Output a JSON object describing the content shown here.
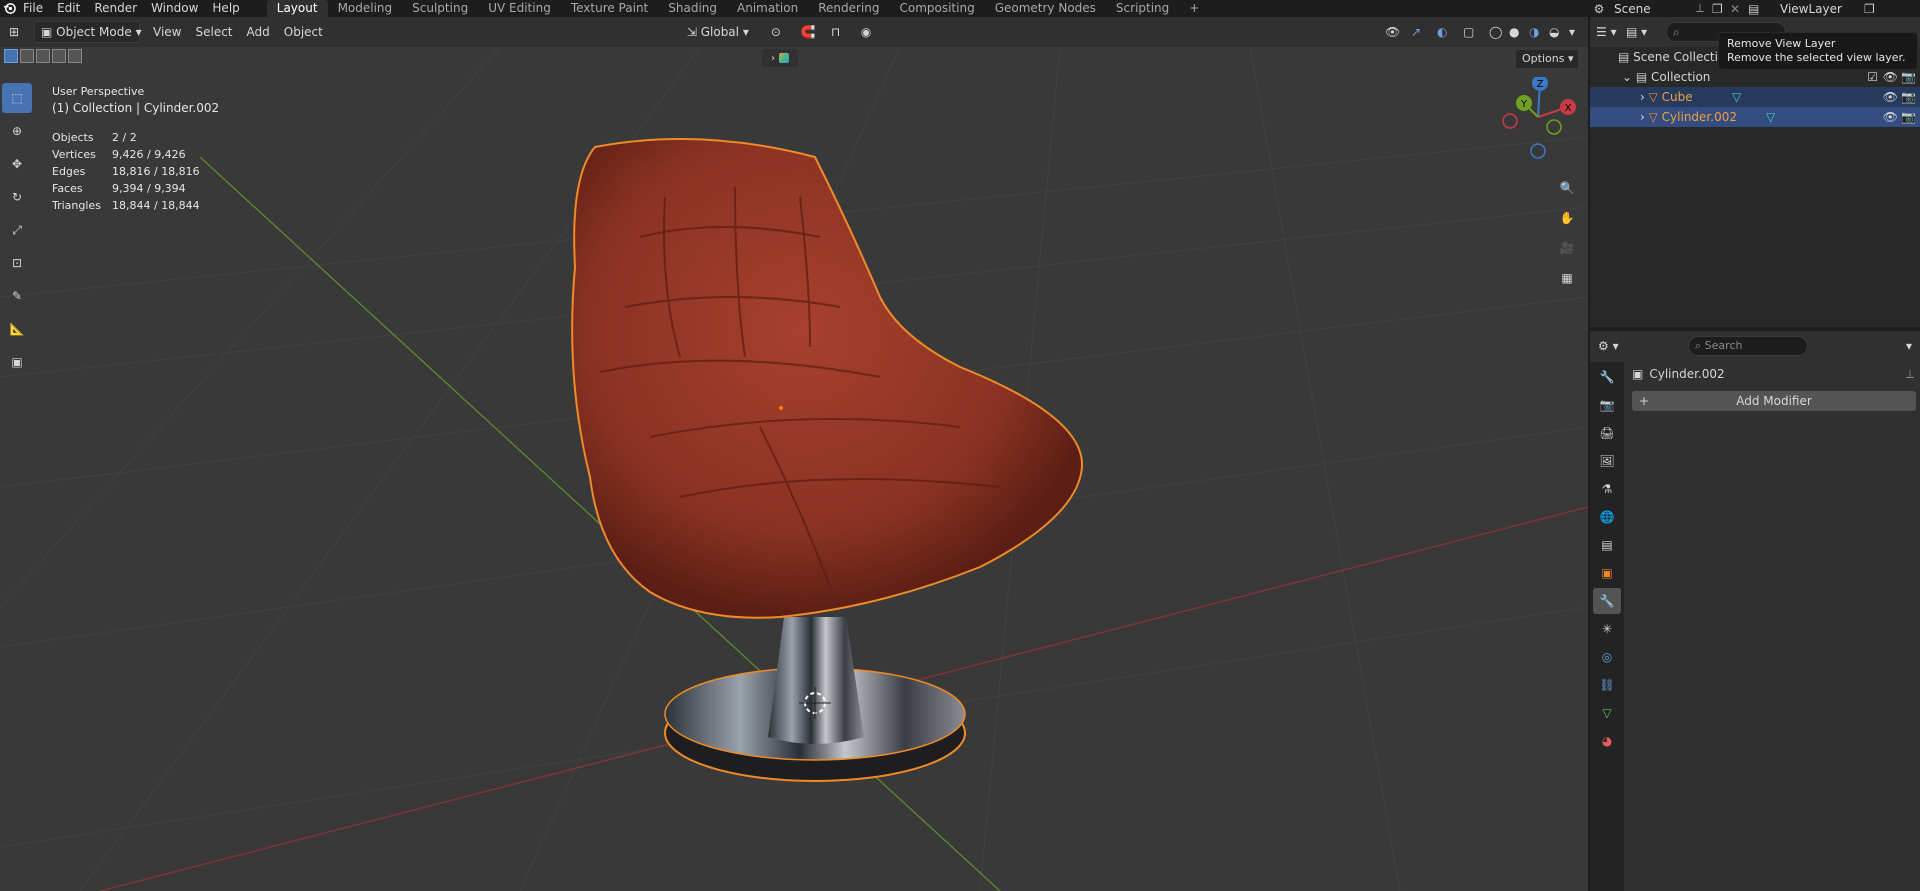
{
  "topbar": {
    "menus": [
      "File",
      "Edit",
      "Render",
      "Window",
      "Help"
    ],
    "workspaces": [
      "Layout",
      "Modeling",
      "Sculpting",
      "UV Editing",
      "Texture Paint",
      "Shading",
      "Animation",
      "Rendering",
      "Compositing",
      "Geometry Nodes",
      "Scripting"
    ],
    "active_workspace": "Layout",
    "add_workspace": "+",
    "scene_name": "Scene",
    "view_layer_name": "ViewLayer"
  },
  "viewport_header": {
    "mode": "Object Mode",
    "menus": [
      "View",
      "Select",
      "Add",
      "Object"
    ],
    "orientation": "Global",
    "options_label": "Options"
  },
  "overlay": {
    "perspective": "User Perspective",
    "context": "(1) Collection | Cylinder.002",
    "stats": [
      {
        "label": "Objects",
        "value": "2 / 2"
      },
      {
        "label": "Vertices",
        "value": "9,426 / 9,426"
      },
      {
        "label": "Edges",
        "value": "18,816 / 18,816"
      },
      {
        "label": "Faces",
        "value": "9,394 / 9,394"
      },
      {
        "label": "Triangles",
        "value": "18,844 / 18,844"
      }
    ]
  },
  "gizmo": {
    "x": "X",
    "y": "Y",
    "z": "Z"
  },
  "outliner": {
    "root": "Scene Collection",
    "collection": "Collection",
    "items": [
      {
        "name": "Cube",
        "selected": false
      },
      {
        "name": "Cylinder.002",
        "selected": true
      }
    ]
  },
  "tooltip": {
    "title": "Remove View Layer",
    "description": "Remove the selected view layer."
  },
  "properties": {
    "search_placeholder": "Search",
    "object_name": "Cylinder.002",
    "add_modifier": "Add Modifier",
    "add_modifier_plus": "+"
  },
  "colors": {
    "accent": "#4772b3",
    "selection_outline": "#f08a28",
    "active_text": "#f0a040",
    "axis_x": "#c83c46",
    "axis_y": "#70a020",
    "axis_z": "#3c78c8"
  }
}
